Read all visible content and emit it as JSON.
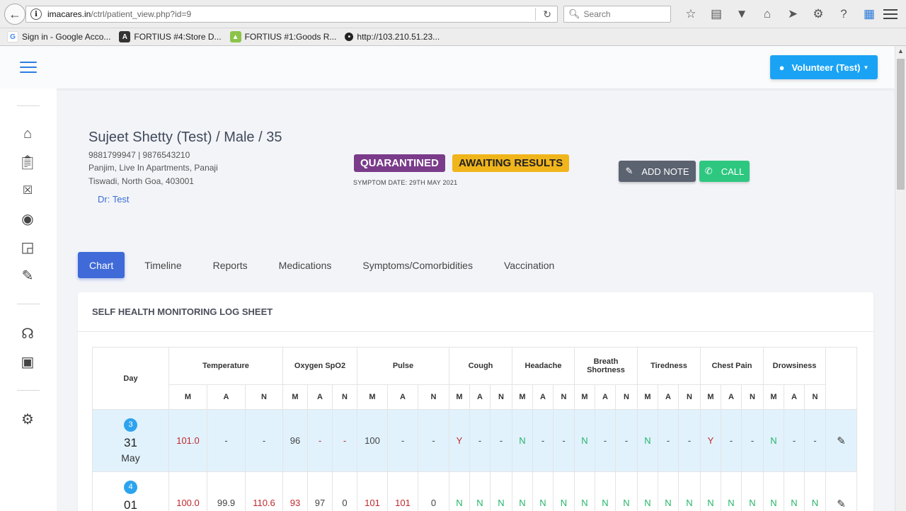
{
  "browser": {
    "url_domain": "imacares.in",
    "url_path": "/ctrl/patient_view.php?id=9",
    "search_placeholder": "Search",
    "bookmarks": [
      {
        "label": "Sign in - Google Acco...",
        "icon": "google-icon",
        "color": "#4285f4"
      },
      {
        "label": "FORTIUS #4:Store D...",
        "icon": "fortius-icon",
        "color": "#333333"
      },
      {
        "label": "FORTIUS #1:Goods R...",
        "icon": "fortius-green-icon",
        "color": "#8bc34a"
      },
      {
        "label": "http://103.210.51.23...",
        "icon": "globe-icon",
        "color": "#222222"
      }
    ]
  },
  "header": {
    "user_button": "Volunteer (Test)"
  },
  "patient": {
    "name_line": "Sujeet Shetty (Test) / Male / 35",
    "phones": "9881799947 | 9876543210",
    "address1": "Panjim, Live In Apartments, Panaji",
    "address2": "Tiswadi, North Goa, 403001",
    "doctor": "Dr: Test",
    "badge_status": "QUARANTINED",
    "badge_result": "AWAITING RESULTS",
    "symptom_date": "SYMPTOM DATE: 29TH MAY 2021",
    "add_note": "ADD NOTE",
    "call": "CALL"
  },
  "tabs": [
    "Chart",
    "Timeline",
    "Reports",
    "Medications",
    "Symptoms/Comorbidities",
    "Vaccination"
  ],
  "log": {
    "title": "SELF HEALTH MONITORING LOG SHEET",
    "day_header": "Day",
    "groups": [
      {
        "label": "Temperature",
        "width": 162
      },
      {
        "label": "Oxygen SpO2",
        "width": 106
      },
      {
        "label": "Pulse",
        "width": 130
      },
      {
        "label": "Cough",
        "width": 89
      },
      {
        "label": "Headache",
        "width": 88
      },
      {
        "label": "Breath Shortness",
        "width": 89
      },
      {
        "label": "Tiredness",
        "width": 89
      },
      {
        "label": "Chest Pain",
        "width": 89
      },
      {
        "label": "Drowsiness",
        "width": 88
      }
    ],
    "sub_labels": [
      "M",
      "A",
      "N"
    ],
    "rows": [
      {
        "day_no": "3",
        "date": "31",
        "month": "May",
        "cells": [
          {
            "v": "101.0",
            "c": "red"
          },
          {
            "v": "-",
            "c": ""
          },
          {
            "v": "-",
            "c": ""
          },
          {
            "v": "96",
            "c": ""
          },
          {
            "v": "-",
            "c": "red"
          },
          {
            "v": "-",
            "c": "red"
          },
          {
            "v": "100",
            "c": ""
          },
          {
            "v": "-",
            "c": ""
          },
          {
            "v": "-",
            "c": ""
          },
          {
            "v": "Y",
            "c": "red"
          },
          {
            "v": "-",
            "c": ""
          },
          {
            "v": "-",
            "c": ""
          },
          {
            "v": "N",
            "c": "green"
          },
          {
            "v": "-",
            "c": ""
          },
          {
            "v": "-",
            "c": ""
          },
          {
            "v": "N",
            "c": "green"
          },
          {
            "v": "-",
            "c": ""
          },
          {
            "v": "-",
            "c": ""
          },
          {
            "v": "N",
            "c": "green"
          },
          {
            "v": "-",
            "c": ""
          },
          {
            "v": "-",
            "c": ""
          },
          {
            "v": "Y",
            "c": "red"
          },
          {
            "v": "-",
            "c": ""
          },
          {
            "v": "-",
            "c": ""
          },
          {
            "v": "N",
            "c": "green"
          },
          {
            "v": "-",
            "c": ""
          },
          {
            "v": "-",
            "c": ""
          }
        ]
      },
      {
        "day_no": "4",
        "date": "01",
        "month": "Jun",
        "cells": [
          {
            "v": "100.0",
            "c": "red"
          },
          {
            "v": "99.9",
            "c": ""
          },
          {
            "v": "110.6",
            "c": "red"
          },
          {
            "v": "93",
            "c": "red"
          },
          {
            "v": "97",
            "c": ""
          },
          {
            "v": "0",
            "c": ""
          },
          {
            "v": "101",
            "c": "red"
          },
          {
            "v": "101",
            "c": "red"
          },
          {
            "v": "0",
            "c": ""
          },
          {
            "v": "N",
            "c": "green"
          },
          {
            "v": "N",
            "c": "green"
          },
          {
            "v": "N",
            "c": "green"
          },
          {
            "v": "N",
            "c": "green"
          },
          {
            "v": "N",
            "c": "green"
          },
          {
            "v": "N",
            "c": "green"
          },
          {
            "v": "N",
            "c": "green"
          },
          {
            "v": "N",
            "c": "green"
          },
          {
            "v": "N",
            "c": "green"
          },
          {
            "v": "N",
            "c": "green"
          },
          {
            "v": "N",
            "c": "green"
          },
          {
            "v": "N",
            "c": "green"
          },
          {
            "v": "N",
            "c": "green"
          },
          {
            "v": "N",
            "c": "green"
          },
          {
            "v": "N",
            "c": "green"
          },
          {
            "v": "N",
            "c": "green"
          },
          {
            "v": "N",
            "c": "green"
          },
          {
            "v": "N",
            "c": "green"
          }
        ]
      }
    ]
  }
}
